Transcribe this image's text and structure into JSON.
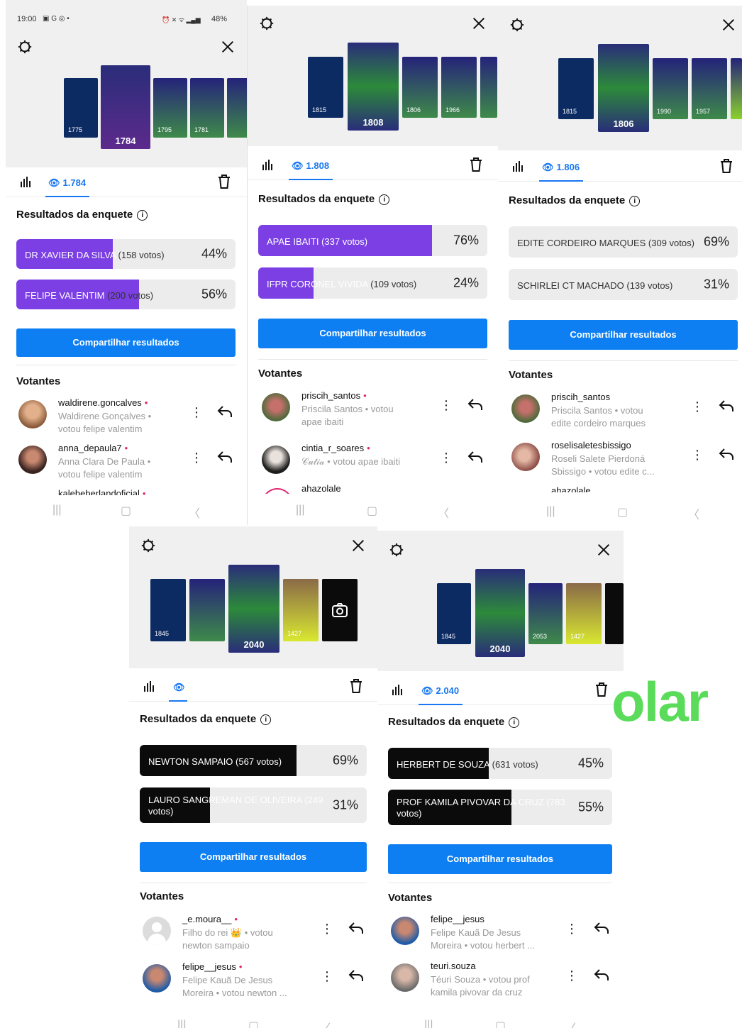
{
  "statusbar": {
    "time": "19:00",
    "left_icons": "▣ G ◎ •",
    "right_icons": "⏰ ✕ ᯤ ▂▄▆",
    "battery": "48%"
  },
  "colors": {
    "panel1_fill": "#7b3fe4",
    "panel2_fill": "#7b3fe4",
    "panel4_fill": "#0b0b0b",
    "panel5_fill": "#0b0b0b",
    "share": "#0d7ff2",
    "eye": "#1877f2"
  },
  "panels": [
    {
      "id": "p1",
      "views_label": "1.784",
      "thumb_views": [
        "1775",
        "1784",
        "1795",
        "1781"
      ],
      "results_title": "Resultados da enquete",
      "info_icon": "i",
      "options": [
        {
          "name": "DR XAVIER DA SILVA",
          "votes": "(158 votos)",
          "percent": "44%",
          "value": 44,
          "filled": true
        },
        {
          "name": "FELIPE VALENTIM",
          "votes": "(200 votos)",
          "percent": "56%",
          "value": 56,
          "filled": true
        }
      ],
      "share_label": "Compartilhar resultados",
      "voters_title": "Votantes",
      "voters": [
        {
          "user": "waldirene.goncalves",
          "line1": "Waldirene Gonçalves •",
          "line2": "votou felipe valentim"
        },
        {
          "user": "anna_depaula7",
          "line1": "Anna Clara De Paula •",
          "line2": "votou felipe valentim"
        },
        {
          "user": "kalebeberlandoficial",
          "line1": "",
          "line2": ""
        }
      ]
    },
    {
      "id": "p2",
      "views_label": "1.808",
      "thumb_views": [
        "1815",
        "1808",
        "1806",
        "1966"
      ],
      "results_title": "Resultados da enquete",
      "info_icon": "i",
      "options": [
        {
          "name": "APAE IBAITI",
          "votes": "(337 votos)",
          "percent": "76%",
          "value": 76,
          "filled": true
        },
        {
          "name": "IFPR CORONEL VIVIDA",
          "votes": "(109 votos)",
          "percent": "24%",
          "value": 24,
          "filled": true
        }
      ],
      "share_label": "Compartilhar resultados",
      "voters_title": "Votantes",
      "voters": [
        {
          "user": "priscih_santos",
          "line1": "Priscila Santos • votou",
          "line2": "apae ibaiti"
        },
        {
          "user": "cintia_r_soares",
          "line1": "𝒞𝓊𝓉𝒾𝒶 • votou apae ibaiti",
          "line2": ""
        },
        {
          "user": "ahazolale",
          "line1": "",
          "line2": ""
        }
      ]
    },
    {
      "id": "p3",
      "views_label": "1.806",
      "thumb_views": [
        "1815",
        "1806",
        "1990",
        "1957"
      ],
      "results_title": "Resultados da enquete",
      "info_icon": "i",
      "options": [
        {
          "name": "EDITE CORDEIRO MARQUES",
          "votes": "(309 votos)",
          "percent": "69%",
          "value": 69,
          "filled": false
        },
        {
          "name": "SCHIRLEI CT MACHADO",
          "votes": "(139 votos)",
          "percent": "31%",
          "value": 31,
          "filled": false
        }
      ],
      "share_label": "Compartilhar resultados",
      "voters_title": "Votantes",
      "voters": [
        {
          "user": "priscih_santos",
          "line1": "Priscila Santos • votou",
          "line2": "edite cordeiro marques"
        },
        {
          "user": "roselisaletesbissigo",
          "line1": "Roseli Salete Pierdoná",
          "line2": "Sbissigo • votou edite c..."
        },
        {
          "user": "ahazolale",
          "line1": "",
          "line2": ""
        }
      ]
    },
    {
      "id": "p4",
      "views_label": "",
      "thumb_views": [
        "1845",
        "2040",
        "1427"
      ],
      "results_title": "Resultados da enquete",
      "info_icon": "i",
      "options": [
        {
          "name": "NEWTON SAMPAIO",
          "votes": "(567 votos)",
          "percent": "69%",
          "value": 69,
          "filled": true
        },
        {
          "name": "LAURO SANGREMAN DE OLIVEIRA (249",
          "votes": "votos)",
          "percent": "31%",
          "value": 31,
          "filled": true
        }
      ],
      "share_label": "Compartilhar resultados",
      "voters_title": "Votantes",
      "voters": [
        {
          "user": "_e.moura__",
          "line1": "Filho do rei 👑 • votou",
          "line2": "newton sampaio"
        },
        {
          "user": "felipe__jesus",
          "line1": "Felipe Kauã De Jesus",
          "line2": "Moreira • votou newton ..."
        }
      ]
    },
    {
      "id": "p5",
      "views_label": "2.040",
      "thumb_views": [
        "1845",
        "2040",
        "2053",
        "1427"
      ],
      "results_title": "Resultados da enquete",
      "info_icon": "i",
      "options": [
        {
          "name": "HERBERT DE SOUZA",
          "votes": "(631 votos)",
          "percent": "45%",
          "value": 45,
          "filled": true
        },
        {
          "name": "PROF KAMILA PIVOVAR DA CRUZ (783",
          "votes": "votos)",
          "percent": "55%",
          "value": 55,
          "filled": true
        }
      ],
      "share_label": "Compartilhar resultados",
      "voters_title": "Votantes",
      "voters": [
        {
          "user": "felipe__jesus",
          "line1": "Felipe Kauã De Jesus",
          "line2": "Moreira • votou herbert ..."
        },
        {
          "user": "teuri.souza",
          "line1": "Téuri Souza • votou prof",
          "line2": "kamila pivovar da cruz"
        }
      ]
    }
  ],
  "watermark": {
    "text": "olar"
  }
}
